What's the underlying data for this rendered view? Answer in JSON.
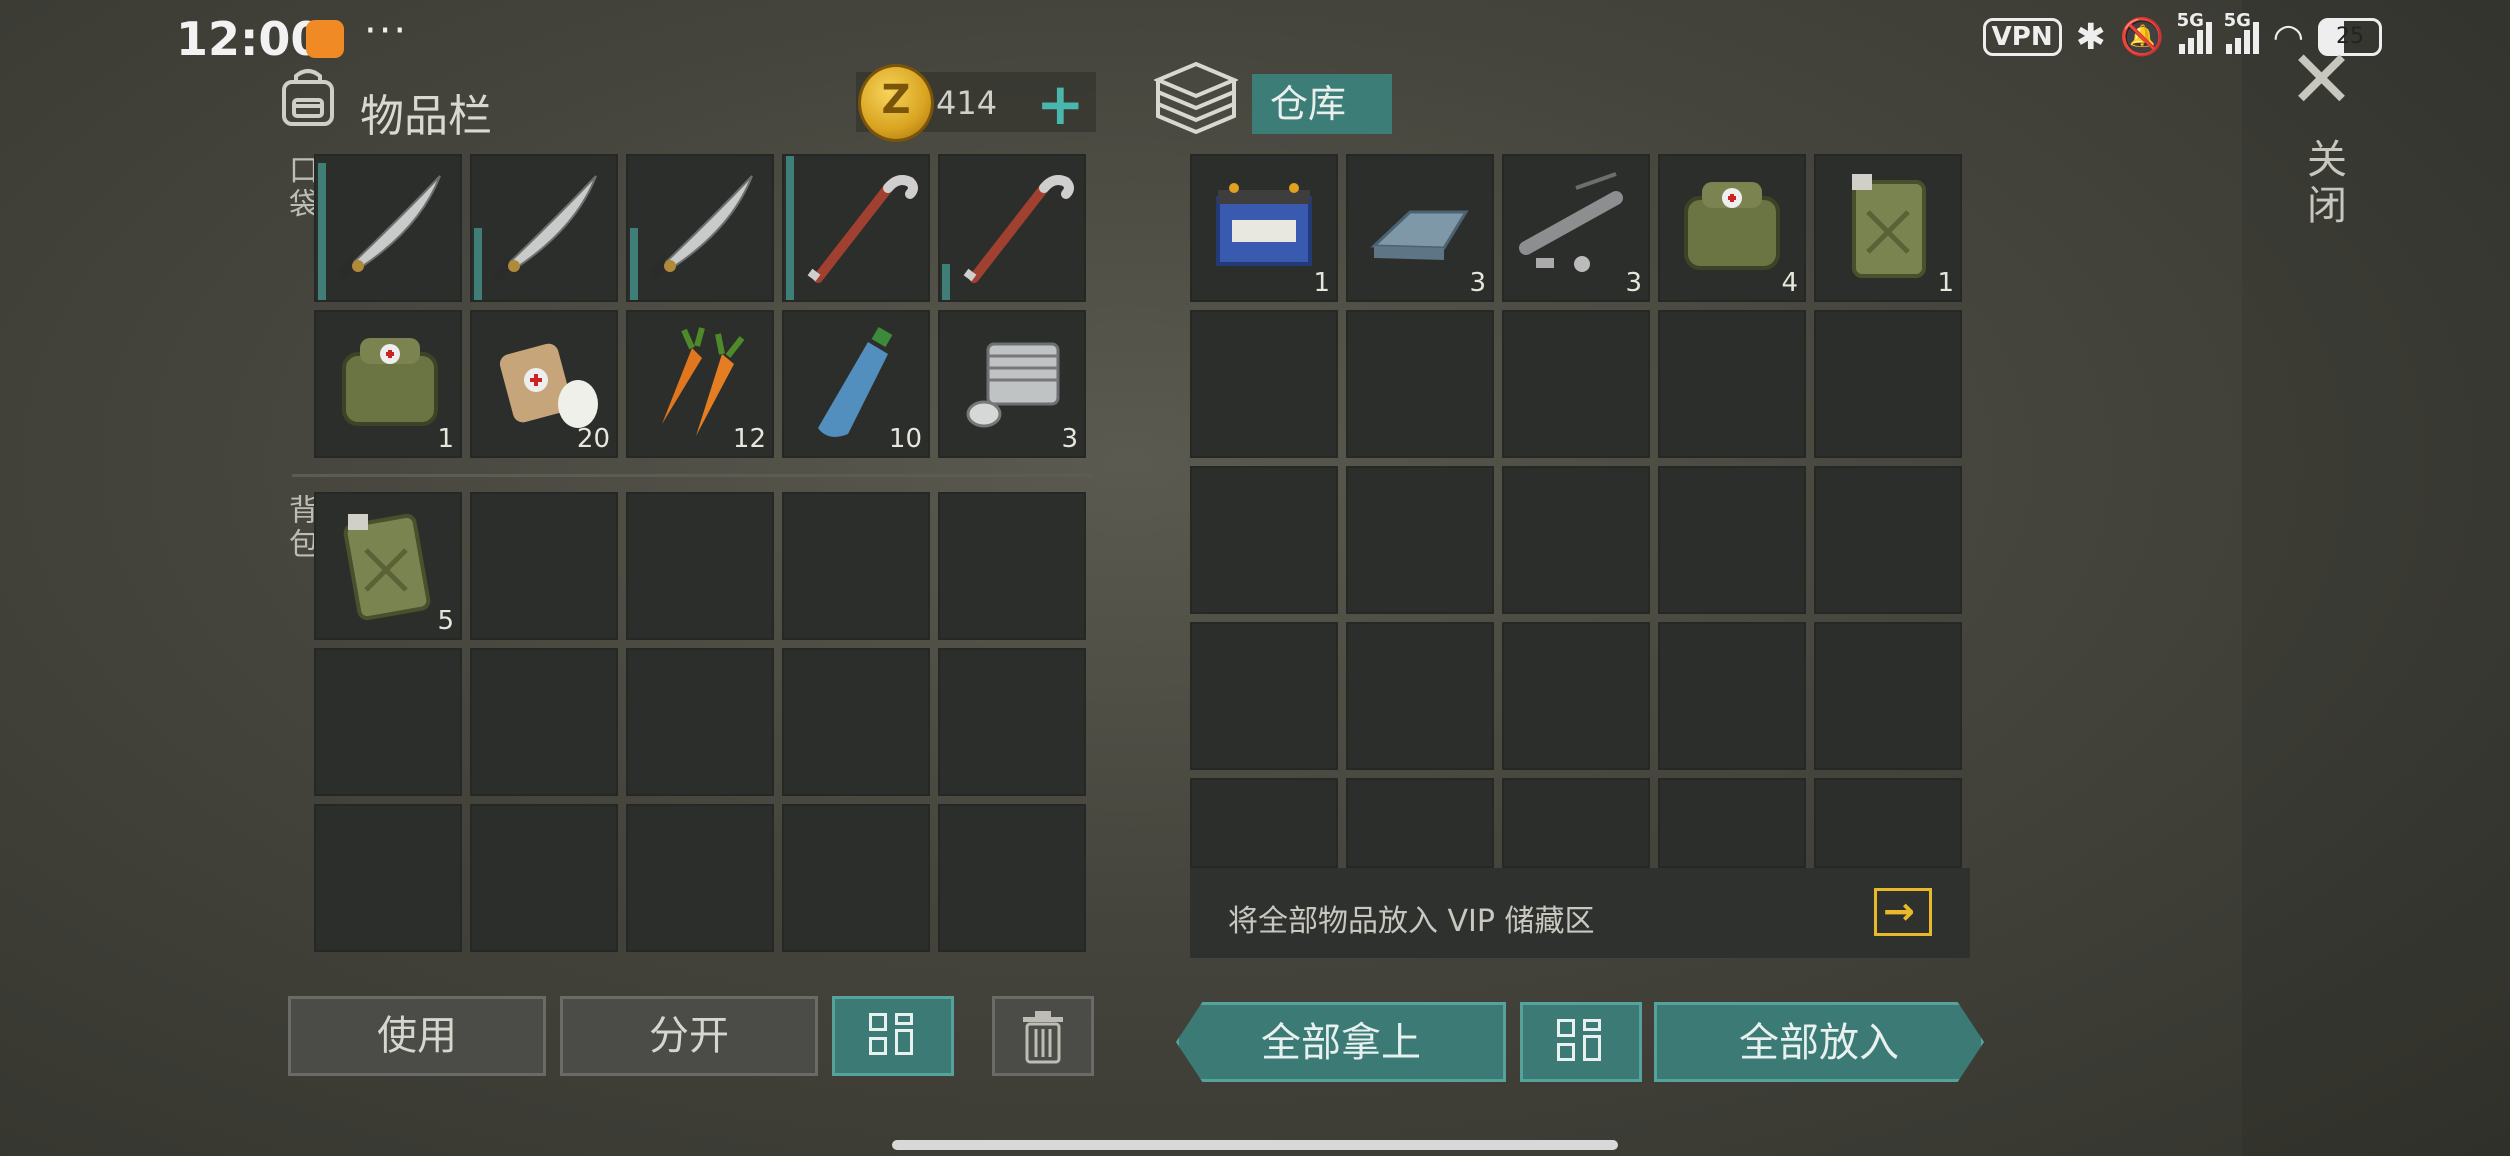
{
  "status": {
    "time": "12:00",
    "dots": "···",
    "vpn": "VPN",
    "net1": "5G",
    "net2": "5G",
    "battery": "25"
  },
  "inventory": {
    "title": "物品栏",
    "coins": "414",
    "pocket_label": "口袋",
    "backpack_label": "背包",
    "pocket_row1": [
      {
        "icon": "machete-icon",
        "qty": "",
        "durability": 0.95
      },
      {
        "icon": "machete-icon",
        "qty": "",
        "durability": 0.5
      },
      {
        "icon": "machete-icon",
        "qty": "",
        "durability": 0.5
      },
      {
        "icon": "crowbar-icon",
        "qty": "",
        "durability": 1.0
      },
      {
        "icon": "crowbar-icon",
        "qty": "",
        "durability": 0.25
      }
    ],
    "pocket_row2": [
      {
        "icon": "medkit-bag-icon",
        "qty": "1"
      },
      {
        "icon": "bandage-icon",
        "qty": "20"
      },
      {
        "icon": "carrot-icon",
        "qty": "12"
      },
      {
        "icon": "water-bottle-icon",
        "qty": "10"
      },
      {
        "icon": "engine-cylinder-icon",
        "qty": "3"
      }
    ],
    "backpack": [
      {
        "icon": "jerrycan-icon",
        "qty": "5"
      }
    ]
  },
  "warehouse": {
    "title": "仓库",
    "items": [
      {
        "icon": "car-battery-icon",
        "qty": "1"
      },
      {
        "icon": "metal-ingot-icon",
        "qty": "3"
      },
      {
        "icon": "pipe-parts-icon",
        "qty": "3"
      },
      {
        "icon": "medkit-bag-icon",
        "qty": "4"
      },
      {
        "icon": "jerrycan-icon",
        "qty": "1"
      }
    ],
    "vip_text": "将全部物品放入 VIP 储藏区"
  },
  "close_label": "关闭",
  "buttons": {
    "use": "使用",
    "split": "分开",
    "take_all": "全部拿上",
    "put_all": "全部放入"
  },
  "colors": {
    "accent_teal": "#3b7a75",
    "coin_gold": "#e0a820",
    "vip_yellow": "#e8b928"
  }
}
